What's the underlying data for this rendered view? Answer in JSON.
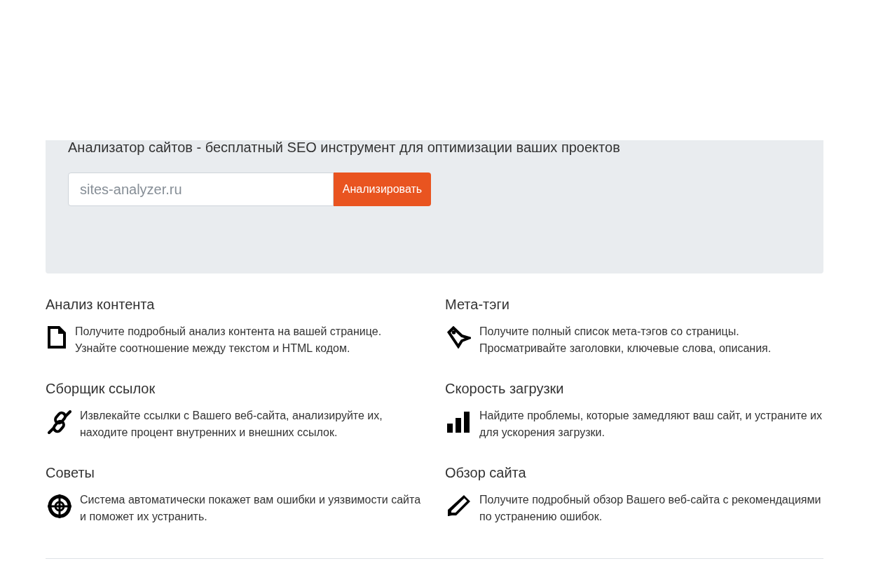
{
  "hero": {
    "title": "Анализатор сайтов - бесплатный SEO инструмент для оптимизации ваших проектов",
    "url_field": {
      "placeholder": "sites-analyzer.ru"
    },
    "button": "Анализировать"
  },
  "features": [
    {
      "title": "Анализ контента",
      "kind": "document",
      "text": "Получите подробный анализ контента на вашей странице. Узнайте соотношение между текстом и HTML кодом."
    },
    {
      "title": "Мета-тэги",
      "kind": "tag",
      "text": "Получите полный список мета-тэгов со страницы. Просматривайте заголовки, ключевые слова, описания."
    },
    {
      "title": "Сборщик ссылок",
      "kind": "link",
      "text": "Извлекайте ссылки с Вашего веб-сайта, анализируйте их, находите процент внутренних и внешних ссылок."
    },
    {
      "title": "Скорость загрузки",
      "kind": "speed",
      "text": "Найдите проблемы, которые замедляют ваш сайт, и устраните их для ускорения загрузки."
    },
    {
      "title": "Советы",
      "kind": "tips",
      "text": "Система автоматически покажет вам ошибки и уязвимости сайта и поможет их устранить."
    },
    {
      "title": "Обзор сайта",
      "kind": "review",
      "text": "Получите подробный обзор Вашего веб-сайта с рекомендациями по устранению ошибок."
    }
  ]
}
